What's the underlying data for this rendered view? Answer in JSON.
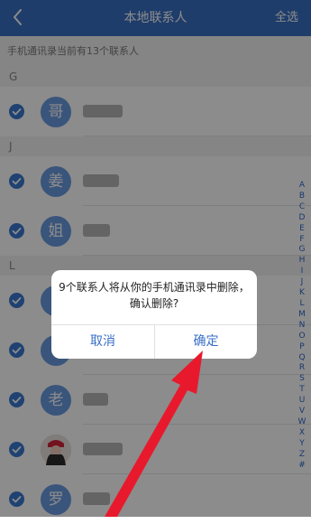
{
  "header": {
    "title": "本地联系人",
    "select_all": "全选",
    "back_icon": "chevron-left-icon"
  },
  "info_text": "手机通讯录当前有13个联系人",
  "sections": [
    {
      "letter": "G",
      "rows": [
        {
          "avatar_char": "哥"
        }
      ]
    },
    {
      "letter": "J",
      "rows": [
        {
          "avatar_char": "姜"
        },
        {
          "avatar_char": "姐"
        }
      ]
    },
    {
      "letter": "L",
      "rows": [
        {
          "avatar_char": ""
        },
        {
          "avatar_char": ""
        },
        {
          "avatar_char": "老"
        },
        {
          "avatar_char": ""
        },
        {
          "avatar_char": "罗"
        }
      ]
    }
  ],
  "index_letters": [
    "A",
    "B",
    "C",
    "D",
    "E",
    "F",
    "G",
    "H",
    "I",
    "J",
    "K",
    "L",
    "M",
    "N",
    "O",
    "P",
    "Q",
    "R",
    "S",
    "T",
    "U",
    "V",
    "W",
    "X",
    "Y",
    "Z",
    "#"
  ],
  "dialog": {
    "message_line1": "9个联系人将从你的手机通讯录中删除，",
    "message_line2": "确认删除?",
    "cancel": "取消",
    "confirm": "确定"
  },
  "colors": {
    "header": "#3a6fc4",
    "accent": "#3a78d0",
    "arrow": "#e8192c"
  }
}
